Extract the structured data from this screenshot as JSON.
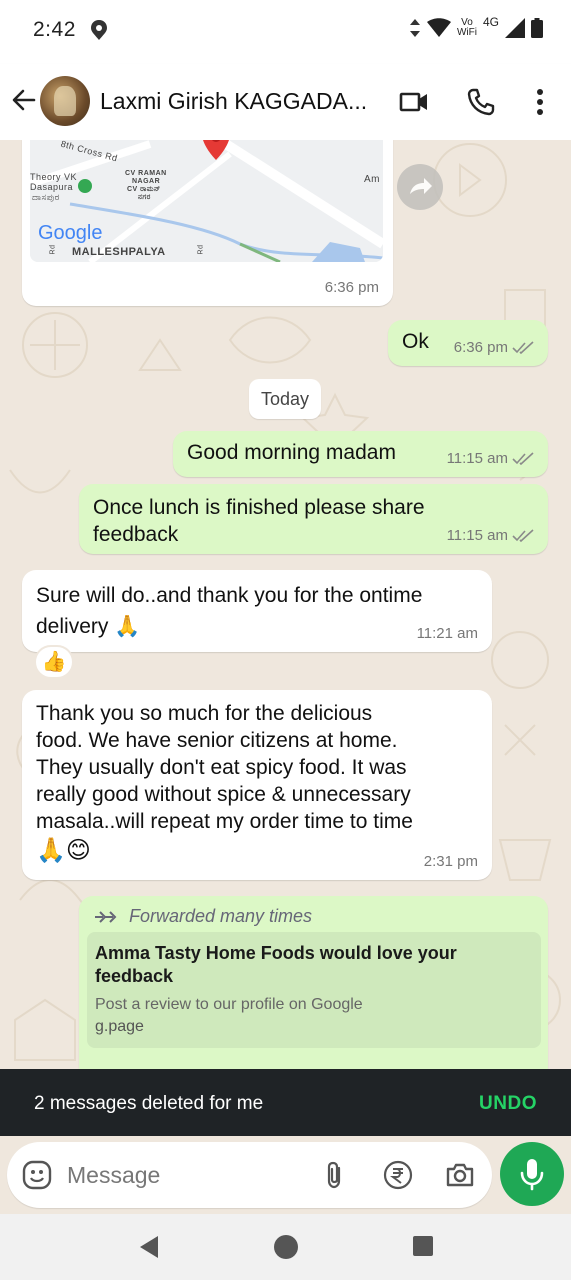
{
  "status_bar": {
    "time": "2:42",
    "network_top": "Vo",
    "network_bottom": "WiFi",
    "signal_type": "4G"
  },
  "header": {
    "contact_name": "Laxmi Girish KAGGADA...",
    "icons": [
      "back-arrow-icon",
      "video-call-icon",
      "phone-icon",
      "more-vert-icon"
    ]
  },
  "map_message": {
    "labels": [
      "8th Cross Rd",
      "Theory VK",
      "Dasapura",
      "ದಾಸಪುರ",
      "CV RAMAN",
      "NAGAR",
      "CV ರಾಮನ್",
      "ನಗರ",
      "Google",
      "MALLESHPALYA",
      "Am",
      "Rd",
      "Rd"
    ],
    "time": "6:36 pm"
  },
  "messages": [
    {
      "id": "ok",
      "direction": "outgoing",
      "text": "Ok",
      "time": "6:36 pm",
      "status": "read"
    },
    {
      "id": "good-morning",
      "direction": "outgoing",
      "text": "Good morning madam",
      "time": "11:15 am",
      "status": "read"
    },
    {
      "id": "feedback-request",
      "direction": "outgoing",
      "lines": [
        "Once lunch is finished please share",
        "feedback"
      ],
      "time": "11:15 am",
      "status": "read"
    },
    {
      "id": "sure",
      "direction": "incoming",
      "lines": [
        "Sure will do..and thank you for the ontime",
        "delivery 🙏"
      ],
      "time": "11:21 am",
      "reaction": "👍"
    },
    {
      "id": "thank-you",
      "direction": "incoming",
      "lines": [
        "Thank you so much for the delicious",
        "food. We have senior citizens at home.",
        "They usually don't eat spicy food.  It was",
        "really good without spice & unnecessary",
        "masala..will repeat my order time to time",
        "🙏😊"
      ],
      "time": "2:31 pm"
    }
  ],
  "date_divider": "Today",
  "forwarded_message": {
    "label": "Forwarded many times",
    "preview_title_lines": [
      "Amma Tasty Home Foods would love your",
      "feedback"
    ],
    "preview_description": "Post a review to our profile on Google",
    "preview_url": "g.page"
  },
  "snackbar": {
    "text": "2 messages deleted for me",
    "action": "UNDO"
  },
  "composer": {
    "placeholder": "Message",
    "icons": [
      "emoji-icon",
      "attach-icon",
      "rupee-payment-icon",
      "camera-icon",
      "mic-icon"
    ]
  },
  "nav_bar": {
    "icons": [
      "nav-back-icon",
      "nav-home-icon",
      "nav-recents-icon"
    ]
  },
  "colors": {
    "outgoing_bubble": "#dcf8c6",
    "incoming_bubble": "#ffffff",
    "chat_background": "#efe7dd",
    "accent_green": "#1fa855",
    "undo_green": "#25d366",
    "tick_grey": "#8a8a8a"
  }
}
